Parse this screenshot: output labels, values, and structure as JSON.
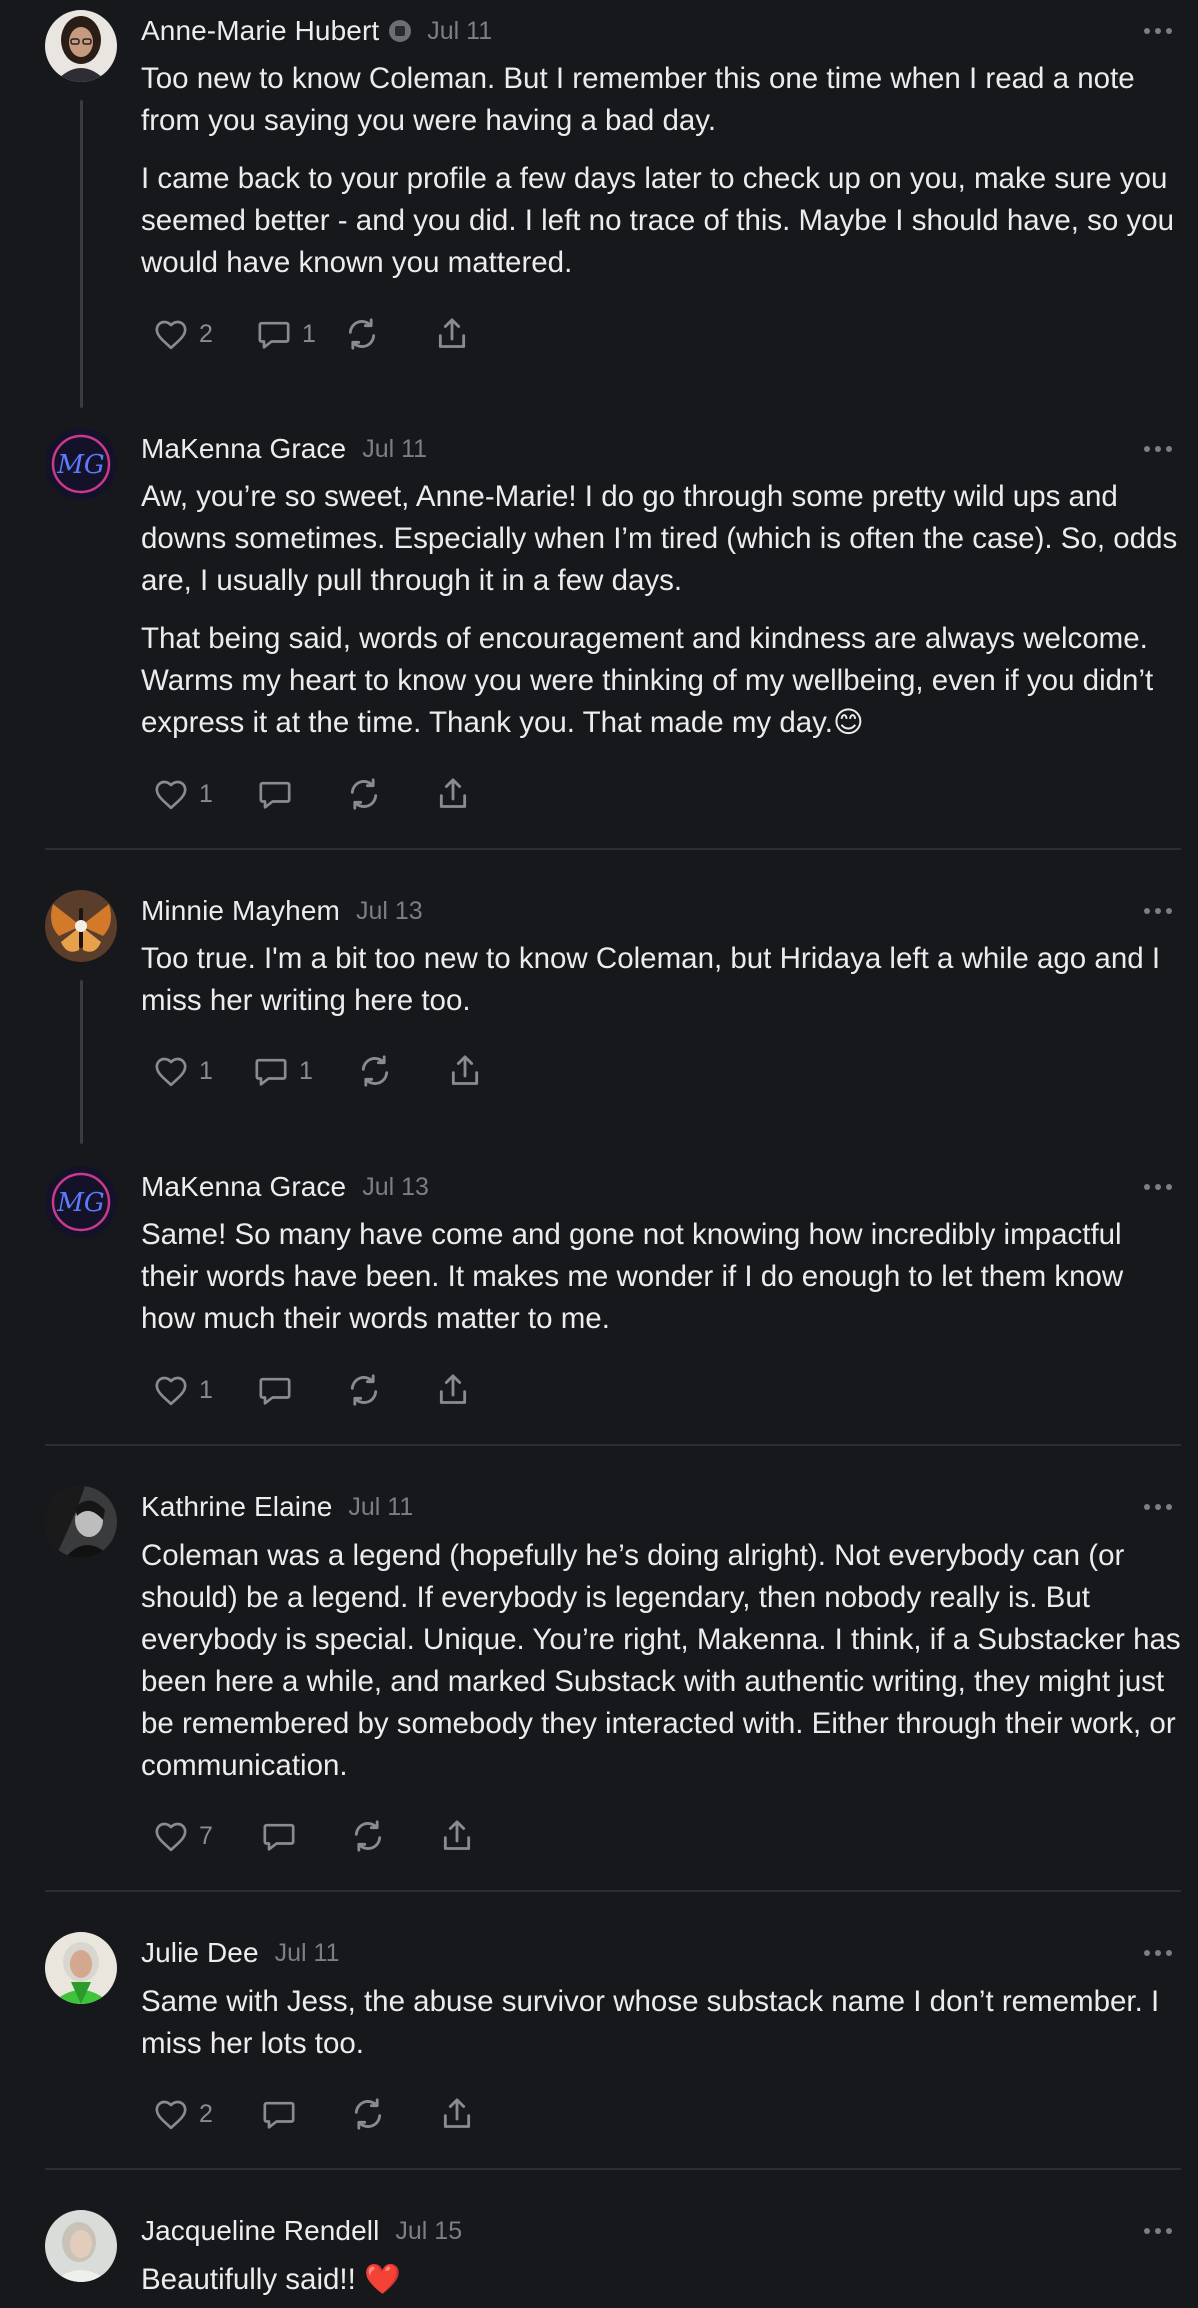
{
  "comments": [
    {
      "author": "Anne-Marie Hubert",
      "date": "Jul 11",
      "paragraphs": [
        "Too new to know Coleman. But I remember this one time when I read a note from you saying you were having a bad day.",
        "I came back to your profile a few days later to check up on you, make sure you seemed better - and you did. I left no trace of this. Maybe I should have, so you would have known you mattered."
      ],
      "likes": "2",
      "replies": "1"
    },
    {
      "author": "MaKenna Grace",
      "date": "Jul 11",
      "paragraphs": [
        "Aw, you’re so sweet, Anne-Marie! I do go through some pretty wild ups and downs sometimes. Especially when I’m tired (which is often the case). So, odds are, I usually pull through it in a few days.",
        "That being said, words of encouragement and kindness are always welcome. Warms my heart to know you were thinking of my wellbeing, even if you didn’t express it at the time. Thank you. That made my day.😊"
      ],
      "likes": "1",
      "replies": ""
    },
    {
      "author": "Minnie Mayhem",
      "date": "Jul 13",
      "paragraphs": [
        "Too true. I'm a bit too new to know Coleman, but Hridaya left a while ago and I miss her writing here too."
      ],
      "likes": "1",
      "replies": "1"
    },
    {
      "author": "MaKenna Grace",
      "date": "Jul 13",
      "paragraphs": [
        "Same! So many have come and gone not knowing how incredibly impactful their words have been. It makes me wonder if I do enough to let them know how much their words matter to me."
      ],
      "likes": "1",
      "replies": ""
    },
    {
      "author": "Kathrine Elaine",
      "date": "Jul 11",
      "paragraphs": [
        "Coleman was a legend (hopefully he’s doing alright). Not everybody can (or should) be a legend. If everybody is legendary, then nobody really is. But everybody is special. Unique. You’re right, Makenna. I think, if a Substacker has been here a while, and marked Substack with authentic writing, they might just be remembered by somebody they interacted with. Either through their work, or communication."
      ],
      "likes": "7",
      "replies": ""
    },
    {
      "author": "Julie Dee",
      "date": "Jul 11",
      "paragraphs": [
        "Same with Jess, the abuse survivor whose substack name I don’t remember. I miss her lots too."
      ],
      "likes": "2",
      "replies": ""
    },
    {
      "author": "Jacqueline Rendell",
      "date": "Jul 15",
      "paragraphs": [
        "Beautifully said!! ❤️"
      ],
      "likes": "",
      "replies": ""
    }
  ],
  "icons": {
    "like": "heart-icon",
    "reply": "speech-bubble-icon",
    "restack": "restack-icon",
    "share": "share-icon",
    "more": "more-dots-icon",
    "badge": "subscriber-badge-icon"
  },
  "colors": {
    "background": "#17181b",
    "text": "#ececed",
    "muted": "#7d7e83",
    "divider": "#2d2e32"
  }
}
